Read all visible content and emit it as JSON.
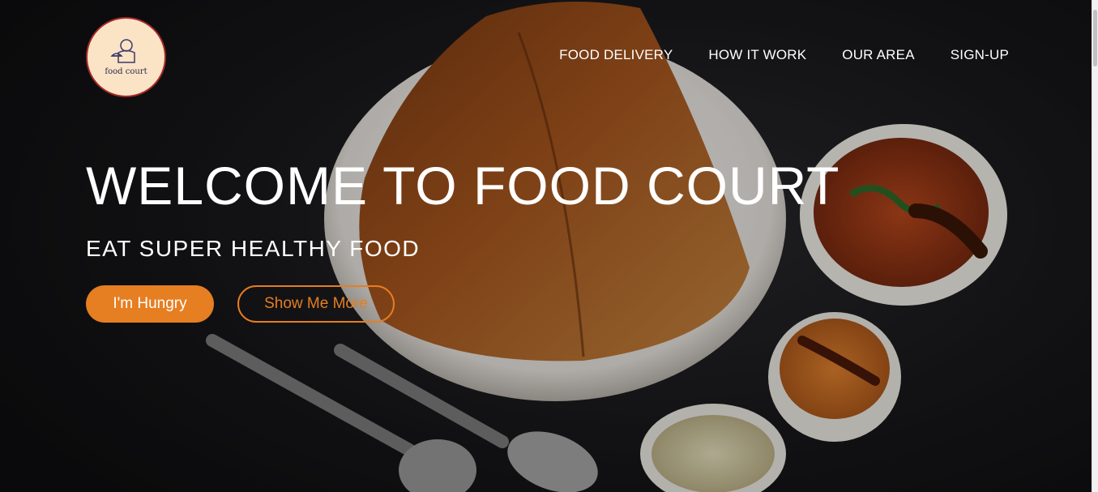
{
  "brand": {
    "logo_text": "food court"
  },
  "nav": {
    "items": [
      {
        "label": "FOOD DELIVERY"
      },
      {
        "label": "HOW IT WORK"
      },
      {
        "label": "OUR AREA"
      },
      {
        "label": "SIGN-UP"
      }
    ]
  },
  "hero": {
    "title": "WELCOME TO FOOD COURT",
    "subtitle": "EAT SUPER HEALTHY FOOD",
    "primary_button": "I'm Hungry",
    "secondary_button": "Show Me More",
    "image_icon": "dosa-plate-image"
  },
  "colors": {
    "accent": "#e67e22",
    "logo_border": "#a52828",
    "logo_bg": "#fbe3c6"
  }
}
